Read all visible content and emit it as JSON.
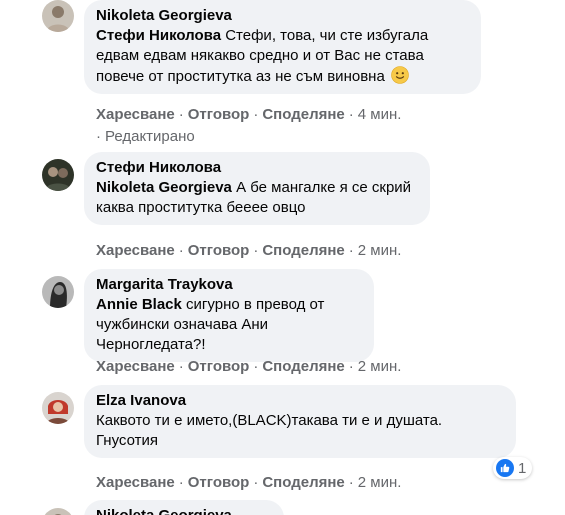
{
  "comments": [
    {
      "author": "Nikoleta Georgieva",
      "mention": "Стефи Николова",
      "text": "Стефи, това, чи сте избугала едвам едвам някакво средно и от Вас не става повече от проститутка аз не съм виновна",
      "emoji": "slightly-smiling-face",
      "actions": {
        "like": "Харесване",
        "reply": "Отговор",
        "share": "Споделяне",
        "time": "4 мин."
      },
      "edited": "Редактирано"
    },
    {
      "author": "Стефи Николова",
      "mention": "Nikoleta Georgieva",
      "text": "А бе мангалке я се скрий каква проститутка бееее овцо",
      "actions": {
        "like": "Харесване",
        "reply": "Отговор",
        "share": "Споделяне",
        "time": "2 мин."
      }
    },
    {
      "author": "Margarita Traykova",
      "mention": "Annie Black",
      "text": "сигурно в превод от чужбински означава Ани Черногледата?!",
      "actions": {
        "like": "Харесване",
        "reply": "Отговор",
        "share": "Споделяне",
        "time": "2 мин."
      }
    },
    {
      "author": "Elza Ivanova",
      "text_line1": "Каквото ти е името,(BLACK)такава ти е и душата.",
      "text_line2": "Гнусотия",
      "reactions": {
        "icon": "like-icon",
        "count": "1",
        "color": "#1877f2"
      },
      "actions": {
        "like": "Харесване",
        "reply": "Отговор",
        "share": "Споделяне",
        "time": "2 мин."
      }
    },
    {
      "author": "Nikoleta Georgieva"
    }
  ],
  "colors": {
    "bubble": "#f0f2f5",
    "secondary_text": "#65676b",
    "primary_text": "#050505",
    "like_blue": "#1877f2"
  }
}
